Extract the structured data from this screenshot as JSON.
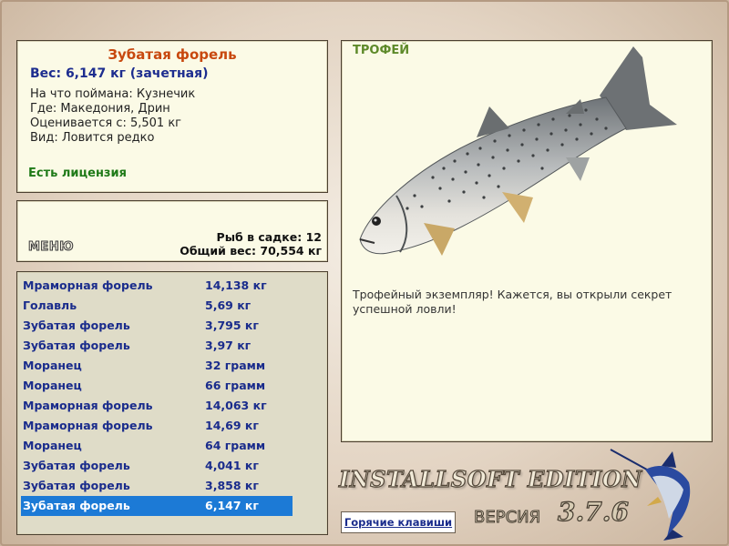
{
  "info": {
    "title": "Зубатая форель",
    "weight": "Вес: 6,147 кг (зачетная)",
    "caught_on": "На что поймана: Кузнечик",
    "location": "Где: Македония, Дрин",
    "valued_from": "Оценивается с: 5,501 кг",
    "kind": "Вид: Ловится редко",
    "license": "Есть лицензия"
  },
  "menu": {
    "button_label": "МЕНЮ",
    "fish_count": "Рыб в садке: 12",
    "total_weight": "Общий вес: 70,554 кг"
  },
  "catch_list": [
    {
      "name": "Мраморная форель",
      "weight": "14,138 кг"
    },
    {
      "name": "Голавль",
      "weight": "5,69 кг"
    },
    {
      "name": "Зубатая форель",
      "weight": "3,795 кг"
    },
    {
      "name": "Зубатая форель",
      "weight": "3,97 кг"
    },
    {
      "name": "Моранец",
      "weight": "32 грамм"
    },
    {
      "name": "Моранец",
      "weight": "66 грамм"
    },
    {
      "name": "Мраморная форель",
      "weight": "14,063 кг"
    },
    {
      "name": "Мраморная форель",
      "weight": "14,69 кг"
    },
    {
      "name": "Моранец",
      "weight": "64 грамм"
    },
    {
      "name": "Зубатая форель",
      "weight": "4,041 кг"
    },
    {
      "name": "Зубатая форель",
      "weight": "3,858 кг"
    },
    {
      "name": "Зубатая форель",
      "weight": "6,147 кг"
    }
  ],
  "selected_index": 11,
  "trophy": {
    "heading": "ТРОФЕЙ",
    "description": "Трофейный экземпляр! Кажется, вы открыли секрет успешной ловли!",
    "image_icon": "trout-illustration"
  },
  "footer": {
    "hotkeys_label": "Горячие клавиши",
    "edition": "INSTALLSOFT EDITION",
    "version_word": "ВЕРСИЯ",
    "version_number": "3.7.6",
    "logo_icon": "marlin-logo"
  },
  "colors": {
    "accent_title": "#c8480e",
    "value_blue": "#1a2c8c",
    "license_green": "#1f7a18",
    "selection": "#1c7ad6",
    "panel_bg": "#fbfae6"
  }
}
